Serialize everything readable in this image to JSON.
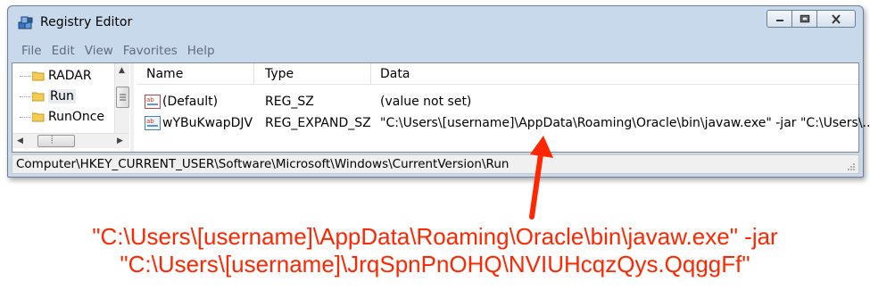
{
  "window": {
    "title": "Registry Editor",
    "icons": {
      "app": "registry-cube-icon",
      "minimize": "minimize-icon",
      "maximize": "maximize-icon",
      "close": "close-icon"
    }
  },
  "menu": [
    "File",
    "Edit",
    "View",
    "Favorites",
    "Help"
  ],
  "tree": {
    "items": [
      {
        "label": "RADAR",
        "selected": false
      },
      {
        "label": "Run",
        "selected": true
      },
      {
        "label": "RunOnce",
        "selected": false
      }
    ],
    "hscroll_glyph": "⦙"
  },
  "list": {
    "columns": [
      "Name",
      "Type",
      "Data"
    ],
    "rows": [
      {
        "icon": "string-value-icon",
        "name": "(Default)",
        "type": "REG_SZ",
        "data": "(value not set)"
      },
      {
        "icon": "expand-string-value-icon",
        "name": "wYBuKwapDJV",
        "type": "REG_EXPAND_SZ",
        "data": "\"C:\\Users\\[username]\\AppData\\Roaming\\Oracle\\bin\\javaw.exe\" -jar \"C:\\Users\\..."
      }
    ]
  },
  "statusbar": {
    "path": "Computer\\HKEY_CURRENT_USER\\Software\\Microsoft\\Windows\\CurrentVersion\\Run"
  },
  "annotation": {
    "line1": "\"C:\\Users\\[username]\\AppData\\Roaming\\Oracle\\bin\\javaw.exe\" -jar",
    "line2": "\"C:\\Users\\[username]\\JrqSpnPnOHQ\\NVIUHcqzQys.QqggFf\"",
    "color": "#ff2600"
  }
}
